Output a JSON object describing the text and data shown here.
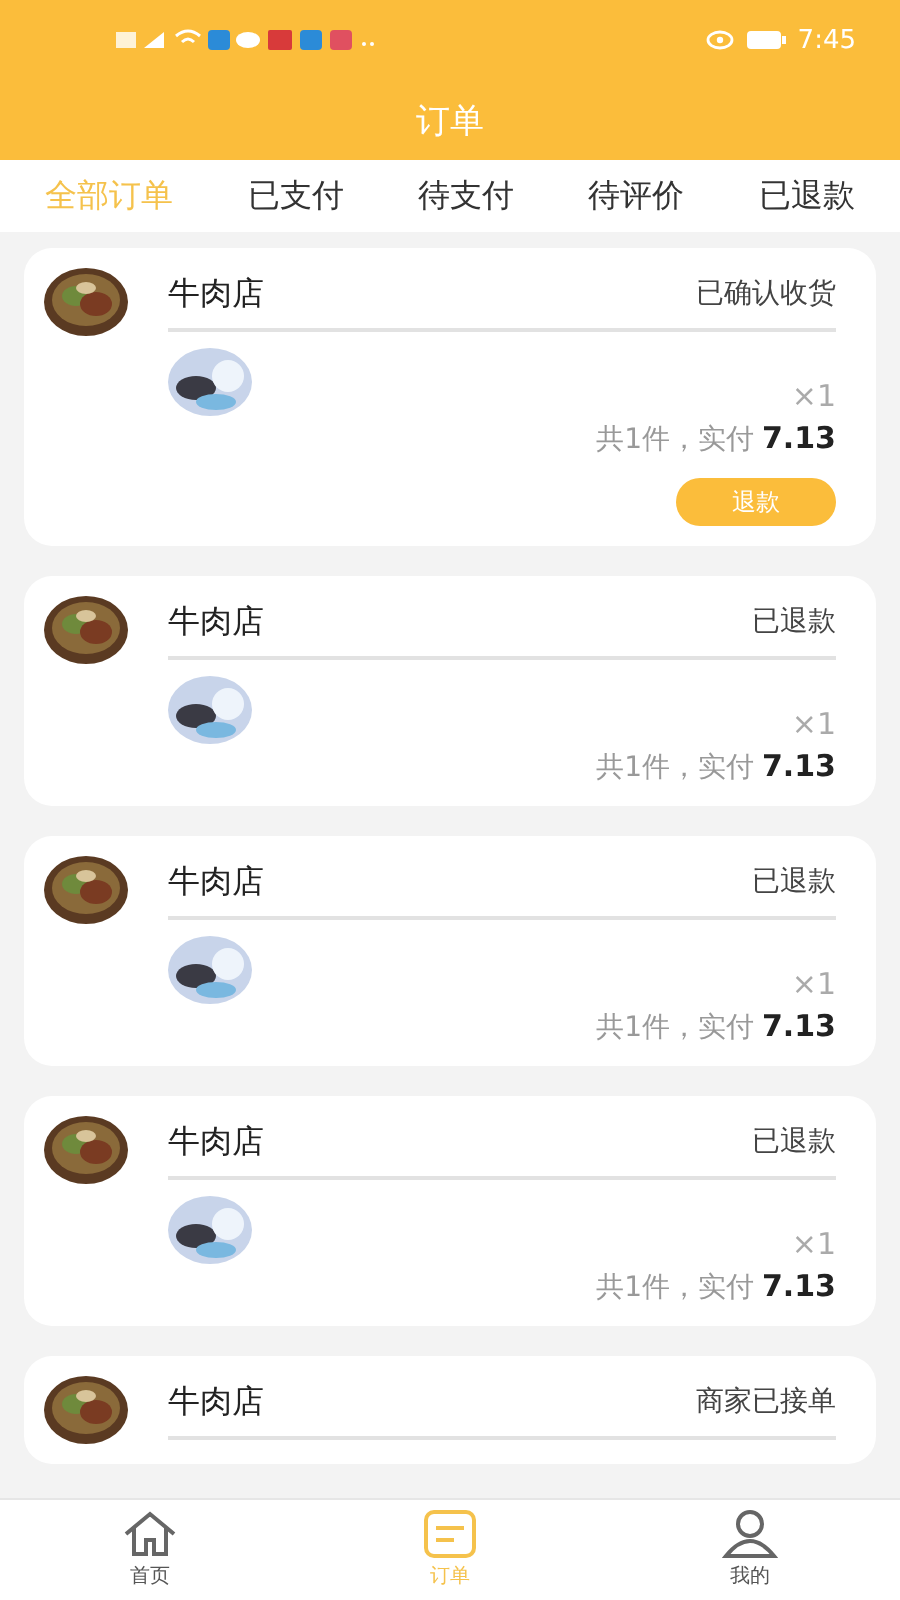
{
  "status_bar": {
    "time": "7:45"
  },
  "header": {
    "title": "订单"
  },
  "tabs": [
    {
      "label": "全部订单",
      "selected": true
    },
    {
      "label": "已支付",
      "selected": false
    },
    {
      "label": "待支付",
      "selected": false
    },
    {
      "label": "待评价",
      "selected": false
    },
    {
      "label": "已退款",
      "selected": false
    }
  ],
  "orders": [
    {
      "shop": "牛肉店",
      "status": "已确认收货",
      "quantity": "×1",
      "summary": "共1件，实付",
      "amount": "7.13",
      "action": "退款"
    },
    {
      "shop": "牛肉店",
      "status": "已退款",
      "quantity": "×1",
      "summary": "共1件，实付",
      "amount": "7.13"
    },
    {
      "shop": "牛肉店",
      "status": "已退款",
      "quantity": "×1",
      "summary": "共1件，实付",
      "amount": "7.13"
    },
    {
      "shop": "牛肉店",
      "status": "已退款",
      "quantity": "×1",
      "summary": "共1件，实付",
      "amount": "7.13"
    },
    {
      "shop": "牛肉店",
      "status": "商家已接单"
    }
  ],
  "nav": [
    {
      "label": "首页",
      "kind": "home",
      "selected": false
    },
    {
      "label": "订单",
      "kind": "orders",
      "selected": true
    },
    {
      "label": "我的",
      "kind": "profile",
      "selected": false
    }
  ]
}
